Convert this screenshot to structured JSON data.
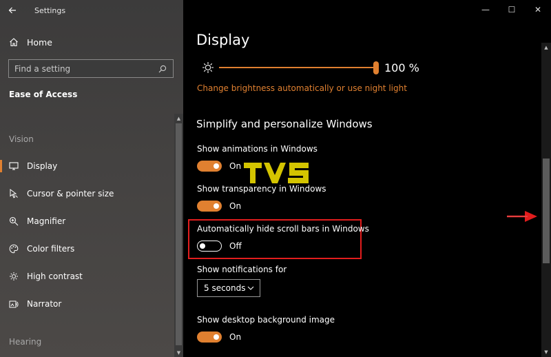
{
  "window": {
    "title": "Settings",
    "controls": {
      "minimize": "—",
      "maximize": "☐",
      "close": "✕"
    }
  },
  "sidebar": {
    "home_label": "Home",
    "search_placeholder": "Find a setting",
    "section_title": "Ease of Access",
    "group_vision": "Vision",
    "group_hearing": "Hearing",
    "items": [
      {
        "label": "Display",
        "icon": "monitor-icon",
        "selected": true
      },
      {
        "label": "Cursor & pointer size",
        "icon": "cursor-icon",
        "selected": false
      },
      {
        "label": "Magnifier",
        "icon": "magnifier-icon",
        "selected": false
      },
      {
        "label": "Color filters",
        "icon": "palette-icon",
        "selected": false
      },
      {
        "label": "High contrast",
        "icon": "contrast-icon",
        "selected": false
      },
      {
        "label": "Narrator",
        "icon": "narrator-icon",
        "selected": false
      }
    ]
  },
  "main": {
    "page_title": "Display",
    "brightness": {
      "value": 100,
      "value_label": "100 %"
    },
    "brightness_link": "Change brightness automatically or use night light",
    "section_heading": "Simplify and personalize Windows",
    "settings": [
      {
        "label": "Show animations in Windows",
        "state": "On"
      },
      {
        "label": "Show transparency in Windows",
        "state": "On"
      },
      {
        "label": "Automatically hide scroll bars in Windows",
        "state": "Off"
      }
    ],
    "notifications": {
      "label": "Show notifications for",
      "selected": "5 seconds"
    },
    "desktop_background": {
      "label": "Show desktop background image",
      "state": "On"
    }
  },
  "colors": {
    "accent": "#e08030",
    "highlight": "#e21d1d",
    "watermark": "#d4c400"
  }
}
